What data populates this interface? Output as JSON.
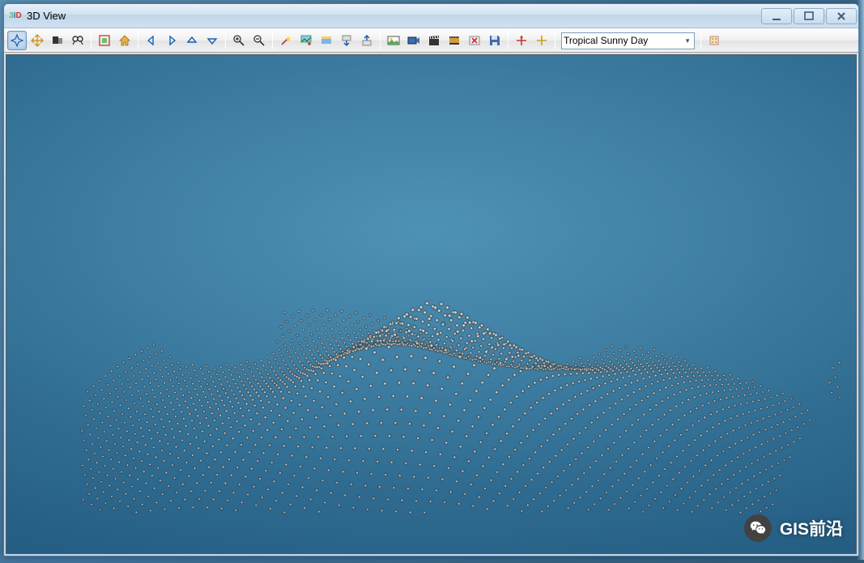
{
  "window": {
    "title": "3D View",
    "icon_text": [
      "3",
      "I",
      "D"
    ]
  },
  "toolbar": {
    "buttons": [
      {
        "name": "navigate-icon",
        "group": 0,
        "active": true
      },
      {
        "name": "pan-icon",
        "group": 0
      },
      {
        "name": "edit-surface-icon",
        "group": 0
      },
      {
        "name": "find-icon",
        "group": 0
      },
      {
        "name": "full-extent-icon",
        "group": 1
      },
      {
        "name": "home-icon",
        "group": 1
      },
      {
        "name": "back-arrow-icon",
        "group": 2
      },
      {
        "name": "forward-arrow-icon",
        "group": 2
      },
      {
        "name": "up-arrow-icon",
        "group": 2
      },
      {
        "name": "down-arrow-icon",
        "group": 2
      },
      {
        "name": "zoom-in-icon",
        "group": 3
      },
      {
        "name": "zoom-out-icon",
        "group": 3
      },
      {
        "name": "wand-icon",
        "group": 4
      },
      {
        "name": "add-layer-icon",
        "group": 4
      },
      {
        "name": "layers-icon",
        "group": 4
      },
      {
        "name": "move-down-icon",
        "group": 4
      },
      {
        "name": "move-up-icon",
        "group": 4
      },
      {
        "name": "picture-icon",
        "group": 5
      },
      {
        "name": "video-icon",
        "group": 5
      },
      {
        "name": "clapboard-icon",
        "group": 5
      },
      {
        "name": "film-icon",
        "group": 5
      },
      {
        "name": "cancel-icon",
        "group": 5
      },
      {
        "name": "save-disk-icon",
        "group": 5
      },
      {
        "name": "pin-red-icon",
        "group": 6
      },
      {
        "name": "pin-add-icon",
        "group": 6
      }
    ],
    "environment_selected": "Tropical Sunny Day",
    "sparkle_button": "scene-settings-icon"
  },
  "watermark": {
    "label": "GIS前沿"
  }
}
